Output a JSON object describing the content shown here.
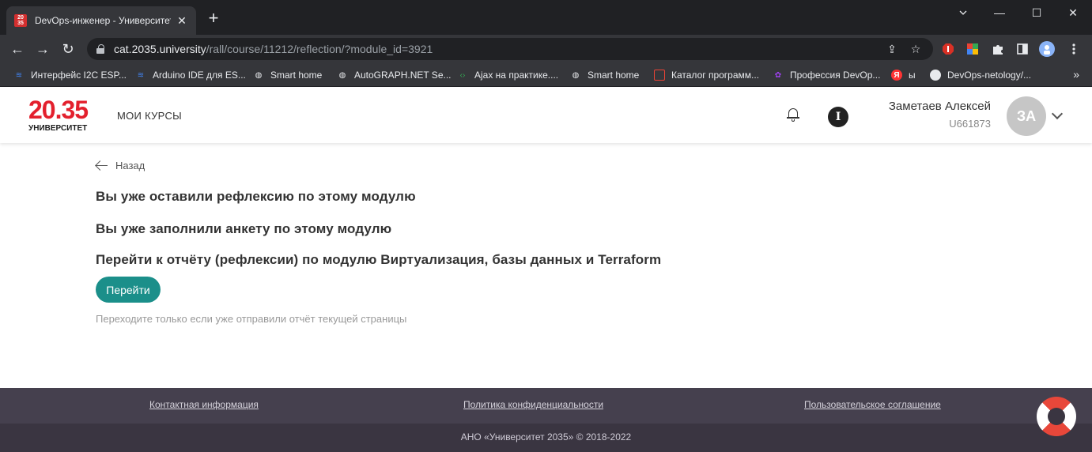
{
  "browser": {
    "tab": {
      "favicon": "20 35",
      "title": "DevOps-инженер - Университет",
      "close": "✕"
    },
    "new_tab": "+",
    "window_controls": {
      "minimize": "—",
      "maximize": "☐",
      "close": "✕"
    },
    "nav": {
      "back": "←",
      "forward": "→",
      "reload": "↻"
    },
    "url": {
      "host": "cat.2035.university",
      "path": "/rall/course/11212/reflection/?module_id=3921"
    },
    "omnibox_icons": {
      "share": "⇪",
      "star": "☆"
    },
    "extensions": [
      {
        "name": "adblock-icon",
        "glyph": "✋",
        "color": "#d93025"
      },
      {
        "name": "colorzilla-icon",
        "glyph": "▣",
        "color": "#5f6368"
      },
      {
        "name": "puzzle-icon",
        "glyph": "✚",
        "color": "#35363a"
      },
      {
        "name": "sidepanel-icon",
        "glyph": "▮",
        "color": "#35363a"
      },
      {
        "name": "profile-icon",
        "glyph": "☺",
        "color": "#8ab4f8"
      },
      {
        "name": "menu-icon",
        "glyph": "⋮",
        "color": "#35363a"
      }
    ],
    "bookmarks": [
      {
        "label": "Интерфейс I2C ESP...",
        "icon": "wifi-icon",
        "glyph": "≋",
        "color": "#4285f4"
      },
      {
        "label": "Arduino IDE для ES...",
        "icon": "wifi-icon",
        "glyph": "≋",
        "color": "#4285f4"
      },
      {
        "label": "Smart home",
        "icon": "globe-icon",
        "glyph": "◍",
        "color": "#e8eaed"
      },
      {
        "label": "AutoGRAPH.NET Se...",
        "icon": "globe-icon",
        "glyph": "◍",
        "color": "#e8eaed"
      },
      {
        "label": "Ajax на практике....",
        "icon": "code-icon",
        "glyph": "‹›",
        "color": "#34a853"
      },
      {
        "label": "Smart home",
        "icon": "globe-icon",
        "glyph": "◍",
        "color": "#e8eaed"
      },
      {
        "label": "Каталог программ...",
        "icon": "catalog-icon",
        "glyph": "▭",
        "color": "#ea4335"
      },
      {
        "label": "Профессия DevOp...",
        "icon": "flower-icon",
        "glyph": "✿",
        "color": "#a142f4"
      },
      {
        "label": "ы",
        "icon": "yandex-icon",
        "glyph": "Я",
        "color": "#ff3333"
      },
      {
        "label": "DevOps-netology/...",
        "icon": "github-icon",
        "glyph": "●",
        "color": "#e8eaed"
      }
    ],
    "bookmarks_more": "»"
  },
  "header": {
    "logo_number": "20.35",
    "logo_text": "УНИВЕРСИТЕТ",
    "nav_courses": "МОИ КУРСЫ",
    "info_badge": "I",
    "user_name": "Заметаев Алексей",
    "user_id": "U661873",
    "avatar_initials": "ЗА"
  },
  "main": {
    "back_label": "Назад",
    "messages": [
      "Вы уже оставили рефлексию по этому модулю",
      "Вы уже заполнили анкету по этому модулю",
      "Перейти к отчёту (рефлексии) по модулю Виртуализация, базы данных и Terraform"
    ],
    "go_button": "Перейти",
    "hint": "Переходите только если уже отправили отчёт текущей страницы"
  },
  "footer": {
    "links": [
      "Контактная информация",
      "Политика конфиденциальности",
      "Пользовательское соглашение"
    ],
    "copyright": "АНО «Университет 2035» © 2018-2022"
  },
  "colors": {
    "brand_red": "#e3202d",
    "accent_teal": "#1b8f8a",
    "footer_bg": "#45404e",
    "footer_bottom_bg": "#3a3541"
  }
}
